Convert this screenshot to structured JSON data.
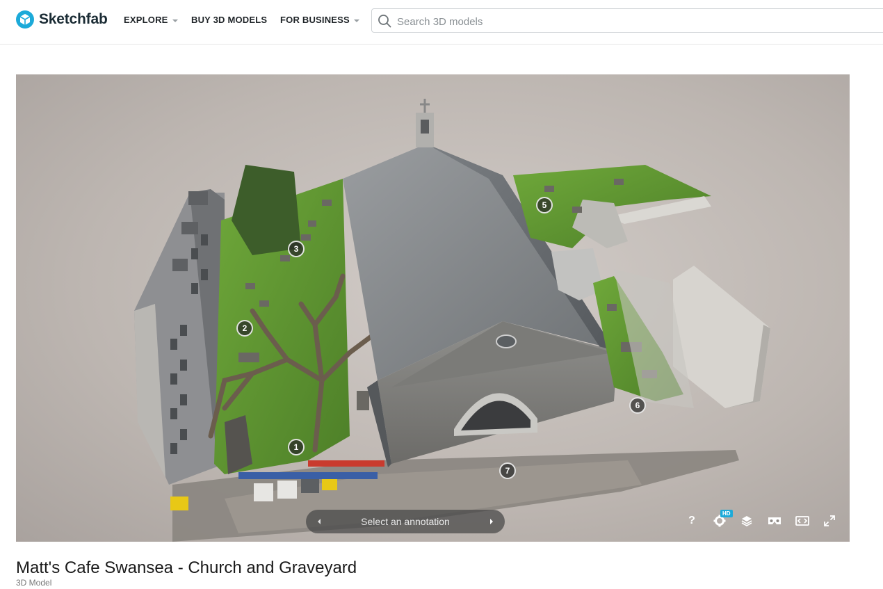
{
  "brand": {
    "name": "Sketchfab",
    "logo_icon": "sketchfab-cube-icon",
    "accent": "#1caad9"
  },
  "nav": {
    "items": [
      {
        "label": "EXPLORE",
        "has_dropdown": true
      },
      {
        "label": "BUY 3D MODELS",
        "has_dropdown": false
      },
      {
        "label": "FOR BUSINESS",
        "has_dropdown": true
      }
    ]
  },
  "search": {
    "placeholder": "Search 3D models",
    "icon": "search-icon"
  },
  "viewer": {
    "annotation_markers": [
      "1",
      "2",
      "3",
      "5",
      "6",
      "7"
    ],
    "annotation_bar": {
      "label": "Select an annotation",
      "prev_icon": "chevron-left-icon",
      "next_icon": "chevron-right-icon"
    },
    "toolbar": {
      "help_label": "?",
      "hd_badge": "HD",
      "icons": [
        "help-icon",
        "settings-icon",
        "layers-icon",
        "vr-icon",
        "embed-icon",
        "fullscreen-icon"
      ]
    }
  },
  "model": {
    "title": "Matt's Cafe Swansea - Church and Graveyard",
    "type_label": "3D Model"
  }
}
